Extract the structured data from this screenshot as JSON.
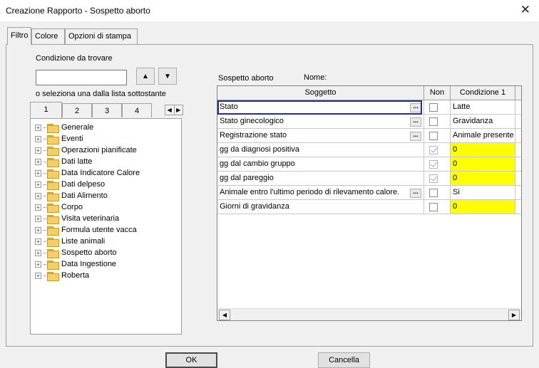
{
  "window": {
    "title": "Creazione Rapporto - Sospetto aborto",
    "close_glyph": "✕"
  },
  "tabs": [
    {
      "label": "Filtro",
      "active": true
    },
    {
      "label": "Colore",
      "active": false
    },
    {
      "label": "Opzioni di stampa",
      "active": false
    }
  ],
  "left": {
    "search_label": "Condizione da trovare",
    "search_value": "",
    "find_up_icon": "binoculars-up-icon",
    "find_down_icon": "binoculars-down-icon",
    "find_up_text": "▲",
    "find_down_text": "▼",
    "hint": "o seleziona una dalla lista sottostante",
    "number_tabs": [
      "1",
      "2",
      "3",
      "4"
    ],
    "scroll_left": "◀",
    "scroll_right": "▶",
    "tree": [
      "Generale",
      "Eventi",
      "Operazioni pianificate",
      "Dati latte",
      "Data Indicatore Calore",
      "Dati delpeso",
      "Dati Alimento",
      "Corpo",
      "Visita veterinaria",
      "Formula utente vacca",
      "Liste animali",
      "Sospetto aborto",
      "Data Ingestione",
      "Roberta"
    ],
    "expander": "+"
  },
  "right": {
    "report_name": "Sospetto aborto",
    "name_label": "Nome:",
    "columns": {
      "subject": "Soggetto",
      "not": "Non",
      "cond1": "Condizione 1"
    },
    "rows": [
      {
        "subject": "Stato",
        "ellipsis": "...",
        "checked": false,
        "condition": "Latte",
        "yellow": false
      },
      {
        "subject": "Stato ginecologico",
        "ellipsis": "...",
        "checked": false,
        "condition": "Gravidanza",
        "yellow": false
      },
      {
        "subject": "Registrazione stato",
        "ellipsis": "...",
        "checked": false,
        "condition": "Animale presente",
        "yellow": false
      },
      {
        "subject": "gg da diagnosi positiva",
        "ellipsis": "",
        "checked": true,
        "condition": "0",
        "yellow": true
      },
      {
        "subject": "gg dal cambio gruppo",
        "ellipsis": "",
        "checked": true,
        "condition": "0",
        "yellow": true
      },
      {
        "subject": "gg dal pareggio",
        "ellipsis": "",
        "checked": true,
        "condition": "0",
        "yellow": true
      },
      {
        "subject": "Animale entro l'ultimo periodo di rilevamento calore.",
        "ellipsis": "...",
        "checked": false,
        "condition": "Si",
        "yellow": false
      },
      {
        "subject": "Giorni di gravidanza",
        "ellipsis": "",
        "checked": false,
        "condition": "0",
        "yellow": true
      }
    ],
    "scroll_left": "◀",
    "scroll_right": "▶",
    "highlight_color": "#ffff00",
    "selection_color": "#1d2ea8"
  },
  "buttons": {
    "ok": "OK",
    "cancel": "Cancella"
  }
}
